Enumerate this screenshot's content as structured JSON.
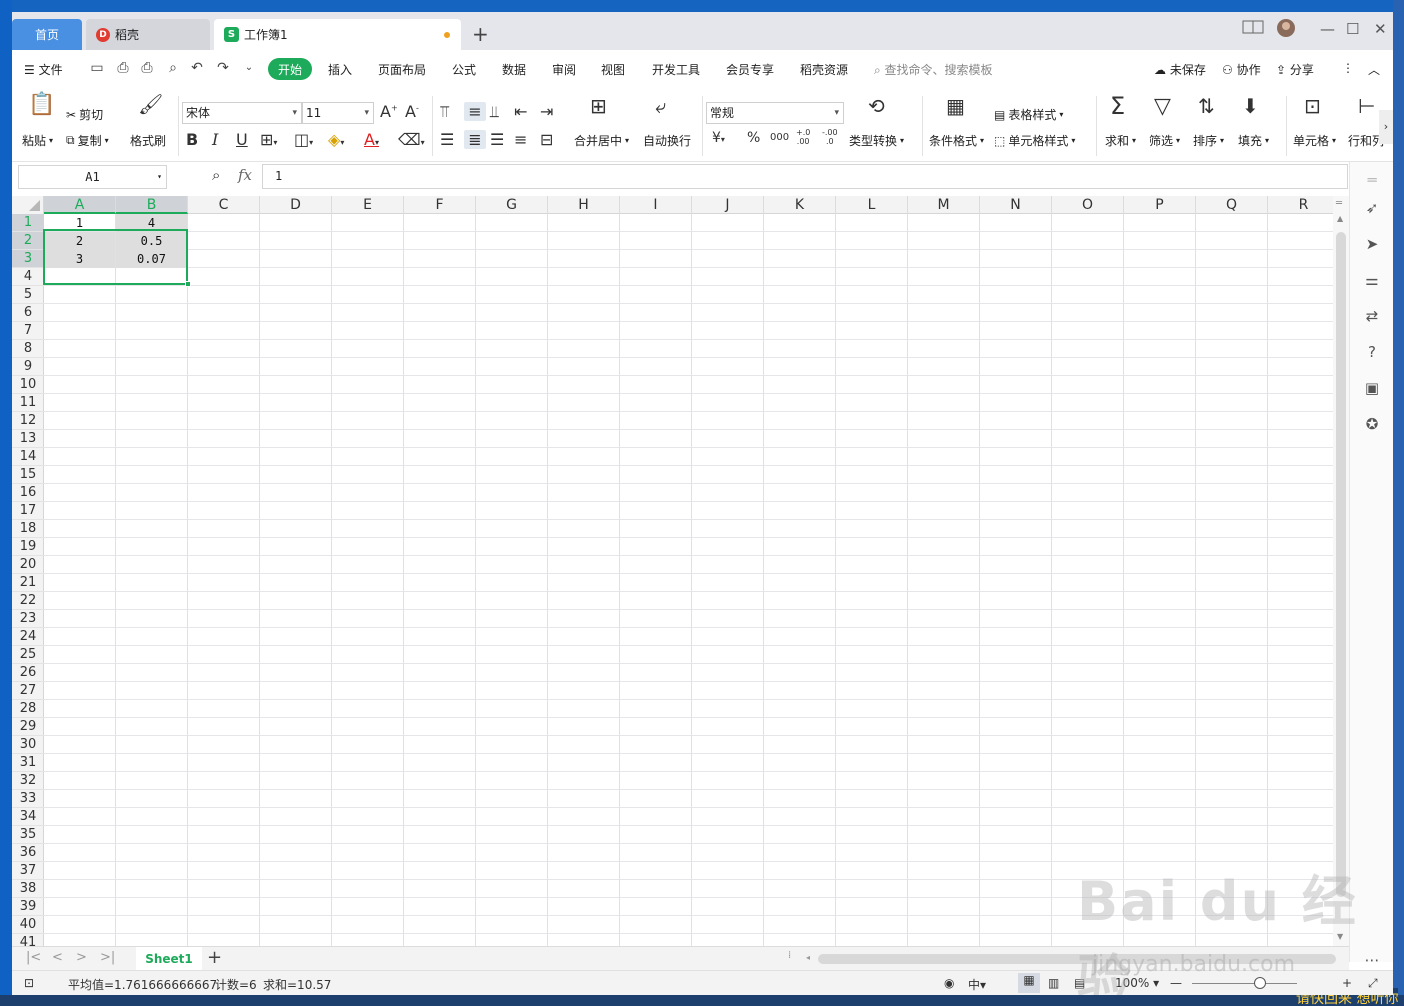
{
  "titlebar": {
    "tabs": [
      {
        "label": "首页"
      },
      {
        "label": "稻壳",
        "logo": "D"
      },
      {
        "label": "工作簿1",
        "logo": "S"
      }
    ],
    "new_tab": "+"
  },
  "menubar": {
    "file_label": "文件",
    "items": [
      "开始",
      "插入",
      "页面布局",
      "公式",
      "数据",
      "审阅",
      "视图",
      "开发工具",
      "会员专享",
      "稻壳资源"
    ],
    "search_placeholder": "查找命令、搜索模板",
    "unsaved": "未保存",
    "collaborate": "协作",
    "share": "分享"
  },
  "ribbon": {
    "paste": "粘贴",
    "cut": "剪切",
    "copy": "复制",
    "format_painter": "格式刷",
    "font_name": "宋体",
    "font_size": "11",
    "bold": "B",
    "italic": "I",
    "underline": "U",
    "merge_center": "合并居中",
    "wrap_text": "自动换行",
    "number_format": "常规",
    "currency": "¥",
    "percent": "%",
    "thousands": "000",
    "inc_decimal": "+.0\n.00",
    "dec_decimal": "-.00\n.0",
    "type_convert": "类型转换",
    "conditional_format": "条件格式",
    "table_style": "表格样式",
    "cell_style": "单元格样式",
    "sum": "求和",
    "filter": "筛选",
    "sort": "排序",
    "fill": "填充",
    "cell": "单元格",
    "row_col": "行和列"
  },
  "formula_bar": {
    "name_box": "A1",
    "fx": "fx",
    "value": "1"
  },
  "grid": {
    "columns": [
      "A",
      "B",
      "C",
      "D",
      "E",
      "F",
      "G",
      "H",
      "I",
      "J",
      "K",
      "L",
      "M",
      "N",
      "O",
      "P",
      "Q",
      "R"
    ],
    "rows": [
      "1",
      "2",
      "3",
      "4",
      "5",
      "6",
      "7",
      "8",
      "9",
      "10",
      "11",
      "12",
      "13",
      "14",
      "15",
      "16",
      "17",
      "18",
      "19",
      "20",
      "21",
      "22",
      "23",
      "24",
      "25",
      "26",
      "27",
      "28",
      "29",
      "30",
      "31",
      "32",
      "33",
      "34",
      "35",
      "36",
      "37",
      "38",
      "39",
      "40",
      "41"
    ],
    "cells": [
      {
        "ref": "A1",
        "value": "1"
      },
      {
        "ref": "B1",
        "value": "4"
      },
      {
        "ref": "A2",
        "value": "2"
      },
      {
        "ref": "B2",
        "value": "0.5"
      },
      {
        "ref": "A3",
        "value": "3"
      },
      {
        "ref": "B3",
        "value": "0.07"
      }
    ]
  },
  "sheets": {
    "active": "Sheet1",
    "add": "+"
  },
  "status": {
    "average": "平均值=1.761666666667",
    "count": "计数=6",
    "sum": "求和=10.57",
    "zoom": "100%"
  },
  "watermark": {
    "main": "Bai du 经验",
    "sub": "jingyan.baidu.com",
    "corner": "请快回来 想听你"
  }
}
